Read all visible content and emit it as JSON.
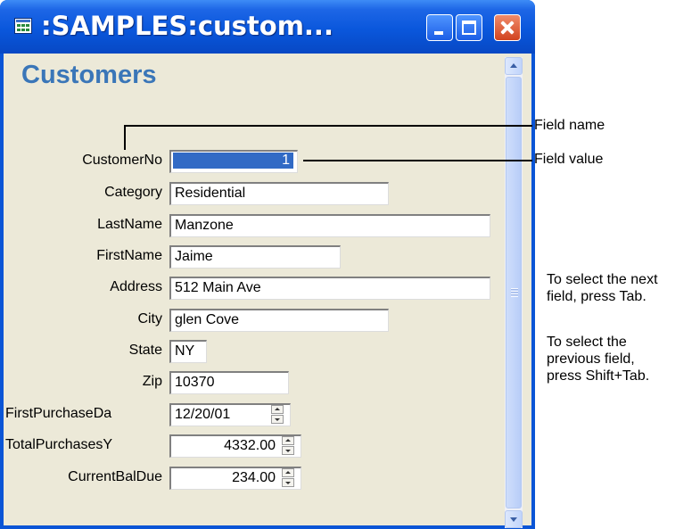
{
  "window": {
    "title": ":SAMPLES:custom...",
    "icon": "table-icon",
    "controls": [
      "minimize-icon",
      "maximize-icon",
      "close-icon"
    ]
  },
  "form": {
    "heading": "Customers",
    "fields": [
      {
        "label": "CustomerNo",
        "value": "1",
        "selected": true
      },
      {
        "label": "Category",
        "value": "Residential"
      },
      {
        "label": "LastName",
        "value": "Manzone"
      },
      {
        "label": "FirstName",
        "value": "Jaime"
      },
      {
        "label": "Address",
        "value": "512 Main Ave"
      },
      {
        "label": "City",
        "value": "glen Cove"
      },
      {
        "label": "State",
        "value": "NY"
      },
      {
        "label": "Zip",
        "value": "10370"
      },
      {
        "label": "FirstPurchaseDa",
        "value": "12/20/01"
      },
      {
        "label": "TotalPurchasesY",
        "value": "4332.00"
      },
      {
        "label": "CurrentBalDue",
        "value": "234.00"
      }
    ]
  },
  "annotations": {
    "field_name": "Field name",
    "field_value": "Field value",
    "next_line1": "To select the next",
    "next_line2": "field, press Tab.",
    "prev_line1": "To select the",
    "prev_line2": "previous field,",
    "prev_line3": "press Shift+Tab."
  },
  "colors": {
    "titlebar": "#0a55d6",
    "heading": "#3a76b8",
    "selection": "#316ac5",
    "client_bg": "#ece9d8"
  }
}
